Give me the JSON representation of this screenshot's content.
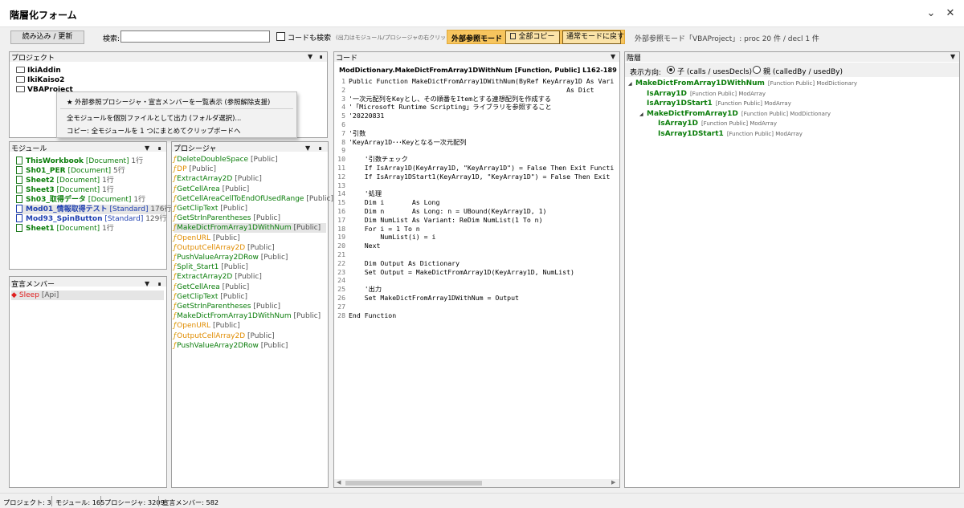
{
  "window": {
    "title": "階層化フォーム"
  },
  "toolbar": {
    "reload_label": "読み込み / 更新",
    "search_label": "検索:",
    "search_value": "",
    "code_search_label": "コードも検索",
    "hint": "(出力はモジュール/プロシージャの右クリック)",
    "ext_mode_label": "外部参照モード",
    "copy_all_label": "全部コピー",
    "normal_mode_label": "通常モードに戻す",
    "ext_status": "外部参照モード「VBAProject」: proc 20 件 / decl 1 件"
  },
  "project_panel": {
    "title": "プロジェクト",
    "items": [
      "IkiAddin",
      "IkiKaiso2",
      "VBAProject"
    ]
  },
  "context_menu": {
    "items": [
      "★ 外部参照プロシージャ・宣言メンバーを一覧表示 (参照解除支援)",
      "全モジュールを個別ファイルとして出力 (フォルダ選択)...",
      "コピー: 全モジュールを 1 つにまとめてクリップボードへ"
    ]
  },
  "module_panel": {
    "title": "モジュール",
    "items": [
      {
        "name": "ThisWorkbook",
        "type": "[Document]",
        "lines": "1行"
      },
      {
        "name": "Sh01_PER",
        "type": "[Document]",
        "lines": "5行"
      },
      {
        "name": "Sheet2",
        "type": "[Document]",
        "lines": "1行"
      },
      {
        "name": "Sheet3",
        "type": "[Document]",
        "lines": "1行"
      },
      {
        "name": "Sh03_取得データ",
        "type": "[Document]",
        "lines": "1行"
      },
      {
        "name": "Mod01_情報取得テスト",
        "type": "[Standard]",
        "lines": "176行"
      },
      {
        "name": "Mod93_SpinButton",
        "type": "[Standard]",
        "lines": "129行"
      },
      {
        "name": "Sheet1",
        "type": "[Document]",
        "lines": "1行"
      }
    ]
  },
  "decl_panel": {
    "title": "宣言メンバー",
    "items": [
      {
        "name": "Sleep",
        "tag": "[Api]"
      }
    ]
  },
  "proc_panel": {
    "title": "プロシージャ",
    "items": [
      {
        "name": "DeleteDoubleSpace",
        "tag": "[Public]",
        "color": "green"
      },
      {
        "name": "DP",
        "tag": "[Public]",
        "color": "orange"
      },
      {
        "name": "ExtractArray2D",
        "tag": "[Public]",
        "color": "green"
      },
      {
        "name": "GetCellArea",
        "tag": "[Public]",
        "color": "green"
      },
      {
        "name": "GetCellAreaCellToEndOfUsedRange",
        "tag": "[Public]",
        "color": "green"
      },
      {
        "name": "GetClipText",
        "tag": "[Public]",
        "color": "green"
      },
      {
        "name": "GetStrInParentheses",
        "tag": "[Public]",
        "color": "green"
      },
      {
        "name": "MakeDictFromArray1DWithNum",
        "tag": "[Public]",
        "color": "green"
      },
      {
        "name": "OpenURL",
        "tag": "[Public]",
        "color": "orange"
      },
      {
        "name": "OutputCellArray2D",
        "tag": "[Public]",
        "color": "orange"
      },
      {
        "name": "PushValueArray2DRow",
        "tag": "[Public]",
        "color": "green"
      },
      {
        "name": "Split_Start1",
        "tag": "[Public]",
        "color": "green"
      },
      {
        "name": "ExtractArray2D",
        "tag": "[Public]",
        "color": "green"
      },
      {
        "name": "GetCellArea",
        "tag": "[Public]",
        "color": "green"
      },
      {
        "name": "GetClipText",
        "tag": "[Public]",
        "color": "green"
      },
      {
        "name": "GetStrInParentheses",
        "tag": "[Public]",
        "color": "green"
      },
      {
        "name": "MakeDictFromArray1DWithNum",
        "tag": "[Public]",
        "color": "green"
      },
      {
        "name": "OpenURL",
        "tag": "[Public]",
        "color": "orange"
      },
      {
        "name": "OutputCellArray2D",
        "tag": "[Public]",
        "color": "orange"
      },
      {
        "name": "PushValueArray2DRow",
        "tag": "[Public]",
        "color": "green"
      }
    ]
  },
  "code_panel": {
    "title": "コード",
    "header": "ModDictionary.MakeDictFromArray1DWithNum  [Function, Public]  L162-189",
    "lines": [
      {
        "n": "1",
        "text": "Public Function MakeDictFromArray1DWithNum(ByRef KeyArray1D As Vari"
      },
      {
        "n": "2",
        "text": "                                                       As Dict"
      },
      {
        "n": "3",
        "text": "'一次元配列をKeyとし、その順番をItemとする連想配列を作成する"
      },
      {
        "n": "4",
        "text": "'「Microsoft Runtime Scripting」ライブラリを参照すること"
      },
      {
        "n": "5",
        "text": "'20220831"
      },
      {
        "n": "6",
        "text": ""
      },
      {
        "n": "7",
        "text": "'引数"
      },
      {
        "n": "8",
        "text": "'KeyArray1D･･･Keyとなる一次元配列"
      },
      {
        "n": "9",
        "text": ""
      },
      {
        "n": "10",
        "text": "    '引数チェック"
      },
      {
        "n": "11",
        "text": "    If IsArray1D(KeyArray1D, \"KeyArray1D\") = False Then Exit Functi"
      },
      {
        "n": "12",
        "text": "    If IsArray1DStart1(KeyArray1D, \"KeyArray1D\") = False Then Exit"
      },
      {
        "n": "13",
        "text": ""
      },
      {
        "n": "14",
        "text": "    '処理"
      },
      {
        "n": "15",
        "text": "    Dim i       As Long"
      },
      {
        "n": "16",
        "text": "    Dim n       As Long: n = UBound(KeyArray1D, 1)"
      },
      {
        "n": "17",
        "text": "    Dim NumList As Variant: ReDim NumList(1 To n)"
      },
      {
        "n": "18",
        "text": "    For i = 1 To n"
      },
      {
        "n": "19",
        "text": "        NumList(i) = i"
      },
      {
        "n": "20",
        "text": "    Next"
      },
      {
        "n": "21",
        "text": ""
      },
      {
        "n": "22",
        "text": "    Dim Output As Dictionary"
      },
      {
        "n": "23",
        "text": "    Set Output = MakeDictFromArray1D(KeyArray1D, NumList)"
      },
      {
        "n": "24",
        "text": ""
      },
      {
        "n": "25",
        "text": "    '出力"
      },
      {
        "n": "26",
        "text": "    Set MakeDictFromArray1DWithNum = Output"
      },
      {
        "n": "27",
        "text": ""
      },
      {
        "n": "28",
        "text": "End Function"
      }
    ]
  },
  "hier_panel": {
    "title": "階層",
    "direction_label": "表示方向:",
    "child_label": "子 (calls / usesDecls)",
    "parent_label": "親 (calledBy / usedBy)",
    "tree": [
      {
        "name": "MakeDictFromArray1DWithNum",
        "meta": "[Function Public]  ModDictionary",
        "level": 0,
        "toggle": "◢"
      },
      {
        "name": "IsArray1D",
        "meta": "[Function Public]  ModArray",
        "level": 1,
        "toggle": ""
      },
      {
        "name": "IsArray1DStart1",
        "meta": "[Function Public]  ModArray",
        "level": 1,
        "toggle": ""
      },
      {
        "name": "MakeDictFromArray1D",
        "meta": "[Function Public]  ModDictionary",
        "level": 1,
        "toggle": "◢"
      },
      {
        "name": "IsArray1D",
        "meta": "[Function Public]  ModArray",
        "level": 2,
        "toggle": ""
      },
      {
        "name": "IsArray1DStart1",
        "meta": "[Function Public]  ModArray",
        "level": 2,
        "toggle": ""
      }
    ]
  },
  "status": {
    "projects": "プロジェクト: 3",
    "modules": "モジュール: 165",
    "procs": "プロシージャ: 3209",
    "decls": "宣言メンバー: 582"
  }
}
